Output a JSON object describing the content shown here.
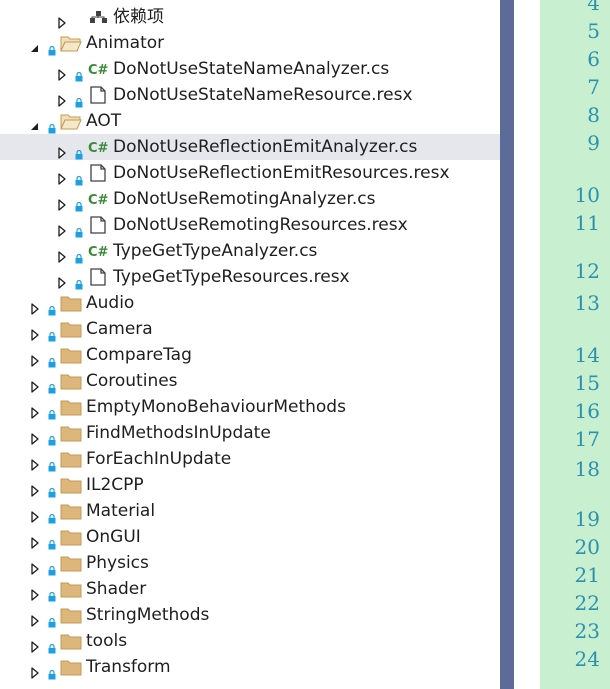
{
  "tree": {
    "rows": [
      {
        "label": "依赖项",
        "level": 1,
        "expander": "right",
        "lock": false,
        "icon": "dependencies-icon"
      },
      {
        "label": "Animator",
        "level": 0,
        "expander": "down",
        "lock": true,
        "icon": "folder-open-icon"
      },
      {
        "label": "DoNotUseStateNameAnalyzer.cs",
        "level": 1,
        "expander": "right",
        "lock": true,
        "icon": "csharp-file-icon"
      },
      {
        "label": "DoNotUseStateNameResource.resx",
        "level": 1,
        "expander": "right",
        "lock": true,
        "icon": "resx-file-icon"
      },
      {
        "label": "AOT",
        "level": 0,
        "expander": "down",
        "lock": true,
        "icon": "folder-open-icon"
      },
      {
        "label": "DoNotUseReflectionEmitAnalyzer.cs",
        "level": 1,
        "expander": "right",
        "lock": true,
        "icon": "csharp-file-icon",
        "selected": true
      },
      {
        "label": "DoNotUseReflectionEmitResources.resx",
        "level": 1,
        "expander": "right",
        "lock": true,
        "icon": "resx-file-icon"
      },
      {
        "label": "DoNotUseRemotingAnalyzer.cs",
        "level": 1,
        "expander": "right",
        "lock": true,
        "icon": "csharp-file-icon"
      },
      {
        "label": "DoNotUseRemotingResources.resx",
        "level": 1,
        "expander": "right",
        "lock": true,
        "icon": "resx-file-icon"
      },
      {
        "label": "TypeGetTypeAnalyzer.cs",
        "level": 1,
        "expander": "right",
        "lock": true,
        "icon": "csharp-file-icon"
      },
      {
        "label": "TypeGetTypeResources.resx",
        "level": 1,
        "expander": "right",
        "lock": true,
        "icon": "resx-file-icon"
      },
      {
        "label": "Audio",
        "level": 0,
        "expander": "right",
        "lock": true,
        "icon": "folder-icon"
      },
      {
        "label": "Camera",
        "level": 0,
        "expander": "right",
        "lock": true,
        "icon": "folder-icon"
      },
      {
        "label": "CompareTag",
        "level": 0,
        "expander": "right",
        "lock": true,
        "icon": "folder-icon"
      },
      {
        "label": "Coroutines",
        "level": 0,
        "expander": "right",
        "lock": true,
        "icon": "folder-icon"
      },
      {
        "label": "EmptyMonoBehaviourMethods",
        "level": 0,
        "expander": "right",
        "lock": true,
        "icon": "folder-icon"
      },
      {
        "label": "FindMethodsInUpdate",
        "level": 0,
        "expander": "right",
        "lock": true,
        "icon": "folder-icon"
      },
      {
        "label": "ForEachInUpdate",
        "level": 0,
        "expander": "right",
        "lock": true,
        "icon": "folder-icon"
      },
      {
        "label": "IL2CPP",
        "level": 0,
        "expander": "right",
        "lock": true,
        "icon": "folder-icon"
      },
      {
        "label": "Material",
        "level": 0,
        "expander": "right",
        "lock": true,
        "icon": "folder-icon"
      },
      {
        "label": "OnGUI",
        "level": 0,
        "expander": "right",
        "lock": true,
        "icon": "folder-icon"
      },
      {
        "label": "Physics",
        "level": 0,
        "expander": "right",
        "lock": true,
        "icon": "folder-icon"
      },
      {
        "label": "Shader",
        "level": 0,
        "expander": "right",
        "lock": true,
        "icon": "folder-icon"
      },
      {
        "label": "StringMethods",
        "level": 0,
        "expander": "right",
        "lock": true,
        "icon": "folder-icon"
      },
      {
        "label": "tools",
        "level": 0,
        "expander": "right",
        "lock": true,
        "icon": "folder-icon"
      },
      {
        "label": "Transform",
        "level": 0,
        "expander": "right",
        "lock": true,
        "icon": "folder-icon"
      }
    ]
  },
  "gutter": {
    "numbers": [
      "4",
      "5",
      "6",
      "7",
      "8",
      "9",
      "10",
      "11",
      "12",
      "13",
      "14",
      "15",
      "16",
      "17",
      "18",
      "19",
      "20",
      "21",
      "22",
      "23",
      "24"
    ]
  },
  "colors": {
    "selection": "#e6e7ec",
    "folder": "#dcb67a",
    "csharp": "#388a34",
    "lock": "#1ba1e2",
    "divider": "#5d6b99",
    "gutter_bg": "#c7efd0",
    "line_number": "#2b91af"
  }
}
